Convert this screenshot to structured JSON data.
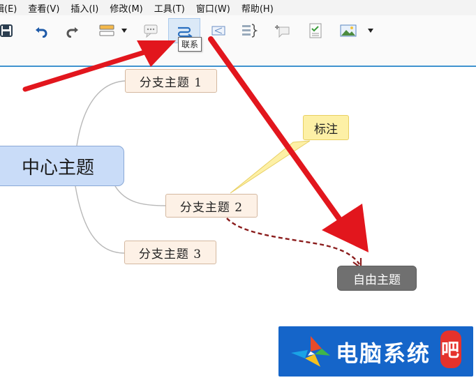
{
  "menu": {
    "items": [
      "辑(E)",
      "查看(V)",
      "插入(I)",
      "修改(M)",
      "工具(T)",
      "窗口(W)",
      "帮助(H)"
    ]
  },
  "toolbar": {
    "tooltip": "联系",
    "active_button": "relationship",
    "buttons": [
      "save-icon",
      "undo-icon",
      "redo-icon",
      "topic-icon",
      "dropdown-arrow-icon",
      "callout-icon",
      "relationship-icon",
      "boundary-icon",
      "summary-icon",
      "label-icon",
      "task-icon",
      "image-icon",
      "dropdown-arrow-icon"
    ]
  },
  "mindmap": {
    "central": "中心主题",
    "branches": [
      "分支主题 1",
      "分支主题 2",
      "分支主题 3"
    ],
    "callout": "标注",
    "floating": "自由主题"
  },
  "watermark": {
    "text": "电脑系统",
    "badge": "吧"
  },
  "colors": {
    "accent": "#3f93cf",
    "central_fill": "#c9dcf8",
    "branch_fill": "#fdf1e6",
    "callout_fill": "#fdf0a6",
    "floating_fill": "#707070",
    "relationship_line": "#8b1d1d",
    "annotation_arrow": "#e2161d",
    "watermark_bg": "#1565c9"
  }
}
